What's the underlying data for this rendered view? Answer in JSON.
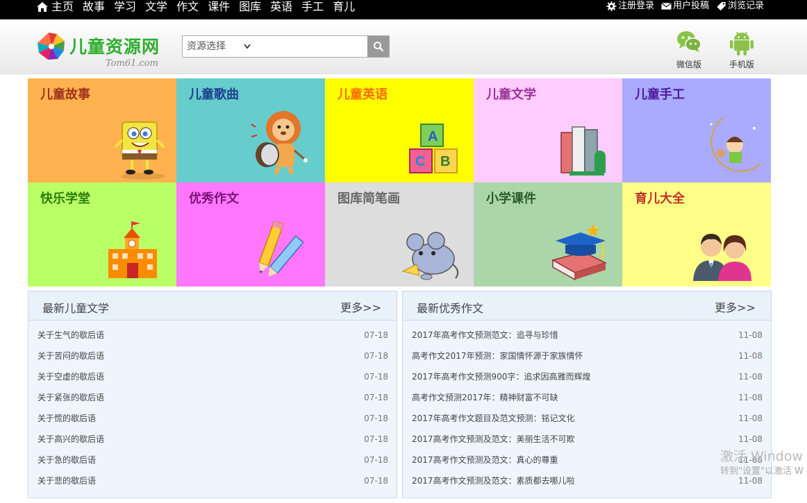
{
  "topnav": {
    "items": [
      "主页",
      "故事",
      "学习",
      "文学",
      "作文",
      "课件",
      "图库",
      "英语",
      "手工",
      "育儿"
    ],
    "links": [
      "注册登录",
      "用户投稿",
      "浏览记录"
    ]
  },
  "header": {
    "logo_text": "儿童资源网",
    "logo_sub": "Tom61.com",
    "search_select": "资源选择",
    "search_placeholder": "",
    "wechat_label": "微信版",
    "mobile_label": "手机版"
  },
  "tiles": [
    {
      "label": "儿童故事",
      "bg": "#ffb24f",
      "color": "#a0331a",
      "icon": "sponge-icon"
    },
    {
      "label": "儿童歌曲",
      "bg": "#66cccc",
      "color": "#1f3f8f",
      "icon": "lion-drum-icon"
    },
    {
      "label": "儿童英语",
      "bg": "#ffff00",
      "color": "#ff6a00",
      "icon": "abc-blocks-icon"
    },
    {
      "label": "儿童文学",
      "bg": "#ffccff",
      "color": "#993399",
      "icon": "books-icon"
    },
    {
      "label": "儿童手工",
      "bg": "#aaaaff",
      "color": "#4b1b9b",
      "icon": "moon-kid-icon"
    },
    {
      "label": "快乐学堂",
      "bg": "#bbff66",
      "color": "#2e7d0e",
      "icon": "school-icon"
    },
    {
      "label": "优秀作文",
      "bg": "#ff77ff",
      "color": "#7b1277",
      "icon": "pencil-icon"
    },
    {
      "label": "图库简笔画",
      "bg": "#dddddd",
      "color": "#666666",
      "icon": "mouse-icon"
    },
    {
      "label": "小学课件",
      "bg": "#aad6aa",
      "color": "#2a5a2a",
      "icon": "graduation-book-icon"
    },
    {
      "label": "育儿大全",
      "bg": "#ffff88",
      "color": "#c0302a",
      "icon": "parents-icon"
    }
  ],
  "panels": [
    {
      "title": "最新儿童文学",
      "more": "更多>>",
      "items": [
        {
          "text": "关于生气的歇后语",
          "date": "07-18"
        },
        {
          "text": "关于苦闷的歇后语",
          "date": "07-18"
        },
        {
          "text": "关于空虚的歇后语",
          "date": "07-18"
        },
        {
          "text": "关于紧张的歇后语",
          "date": "07-18"
        },
        {
          "text": "关于慌的歇后语",
          "date": "07-18"
        },
        {
          "text": "关于高兴的歇后语",
          "date": "07-18"
        },
        {
          "text": "关于急的歇后语",
          "date": "07-18"
        },
        {
          "text": "关于悲的歇后语",
          "date": "07-18"
        }
      ]
    },
    {
      "title": "最新优秀作文",
      "more": "更多>>",
      "items": [
        {
          "text": "2017年高考作文预测范文：追寻与珍惜",
          "date": "11-08"
        },
        {
          "text": "高考作文2017年预测：家国情怀源于家族情怀",
          "date": "11-08"
        },
        {
          "text": "2017年高考作文预测900字：追求因高雅而辉煌",
          "date": "11-08"
        },
        {
          "text": "高考作文预测2017年：精神财富不可缺",
          "date": "11-08"
        },
        {
          "text": "2017年高考作文题目及范文预测：铭记文化",
          "date": "11-08"
        },
        {
          "text": "2017高考作文预测及范文：美丽生活不可欺",
          "date": "11-08"
        },
        {
          "text": "2017高考作文预测及范文：真心的尊重",
          "date": "11-08"
        },
        {
          "text": "2017高考作文预测及范文：素质都去哪儿啦",
          "date": "11-08"
        }
      ]
    }
  ],
  "watermark": {
    "line1": "激活 Window",
    "line2": "转到\"设置\"以激活 W"
  }
}
